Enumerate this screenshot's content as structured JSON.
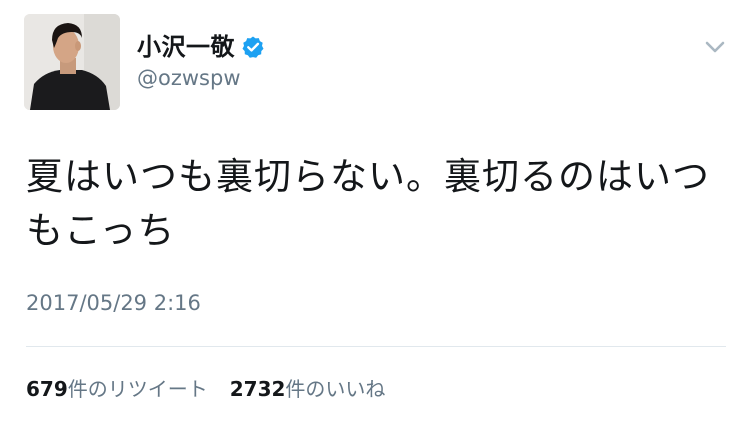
{
  "author": {
    "display_name": "小沢一敬",
    "handle": "@ozwspw",
    "verified": true,
    "verified_color": "#1da1f2"
  },
  "tweet": {
    "text": "夏はいつも裏切らない。裏切るのはいつもこっち",
    "timestamp": "2017/05/29 2:16"
  },
  "stats": {
    "retweet_count": "679",
    "retweet_label": "件のリツイート",
    "like_count": "2732",
    "like_label": "件のいいね"
  },
  "icons": {
    "caret": "chevron-down-icon",
    "verified": "verified-badge-icon"
  },
  "colors": {
    "text_primary": "#14171a",
    "text_secondary": "#657786",
    "divider": "#e1e8ed",
    "accent": "#1da1f2"
  }
}
